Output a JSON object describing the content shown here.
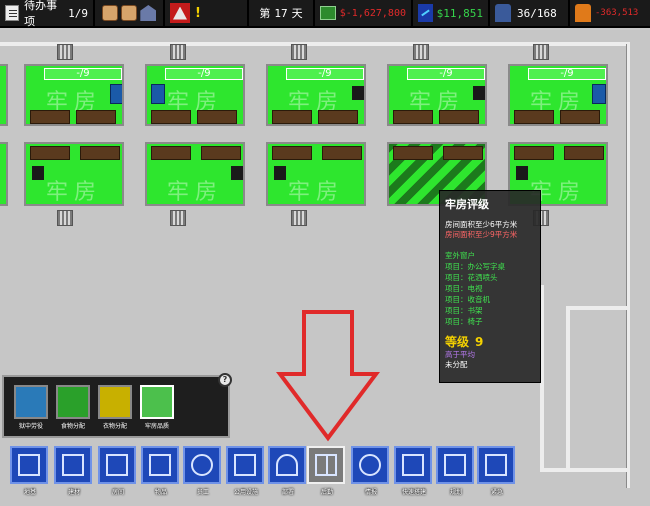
{
  "hud": {
    "todo_label": "待办事项",
    "todo_count": "1/9",
    "warn_mark": "!",
    "day_prefix": "第",
    "day_number": "17",
    "day_suffix": "天",
    "balance": "$-1,627,800",
    "income": "$11,851",
    "guards": "36/168",
    "prisoner_value": "-363,513",
    "colors": {
      "negative": "#e02a2a",
      "positive": "#35d44b",
      "accent": "#f4d100"
    }
  },
  "cells": {
    "tag": "-/9",
    "name": "牢房"
  },
  "tooltip": {
    "title": "牢房评级",
    "req1": "房间面积至少6平方米",
    "req2": "房间面积至少9平方米",
    "section": "室外窗户",
    "items": [
      "项目：办公写字桌",
      "项目：花洒喷头",
      "项目：电视",
      "项目：收音机",
      "项目：书架",
      "项目：椅子"
    ],
    "grade_label": "等级",
    "grade_value": "9",
    "grade_desc": "高于平均",
    "assign": "未分配"
  },
  "subpanel": {
    "close": "?",
    "items": [
      {
        "label": "狱中劳役",
        "icon": "labor-icon",
        "color": "#2a7ab8"
      },
      {
        "label": "食物分配",
        "icon": "food-icon",
        "color": "#2aa02a"
      },
      {
        "label": "衣物分配",
        "icon": "clothing-icon",
        "color": "#c8b000"
      },
      {
        "label": "牢房品质",
        "icon": "cell-quality-icon",
        "color": "#4cc04c"
      }
    ]
  },
  "toolbar": {
    "items": [
      {
        "label": "地基",
        "icon": "foundation-icon"
      },
      {
        "label": "建材",
        "icon": "materials-icon"
      },
      {
        "label": "房间",
        "icon": "rooms-icon"
      },
      {
        "label": "物品",
        "icon": "objects-icon"
      },
      {
        "label": "员工",
        "icon": "staff-icon"
      },
      {
        "label": "公用设施",
        "icon": "utilities-icon"
      },
      {
        "label": "部署",
        "icon": "deploy-icon"
      },
      {
        "label": "后勤",
        "icon": "logistics-icon"
      },
      {
        "label": "情报",
        "icon": "intelligence-icon"
      },
      {
        "label": "快速搭建",
        "icon": "quick-build-icon"
      },
      {
        "label": "规划",
        "icon": "planning-icon"
      },
      {
        "label": "紧急",
        "icon": "emergency-icon"
      }
    ]
  }
}
